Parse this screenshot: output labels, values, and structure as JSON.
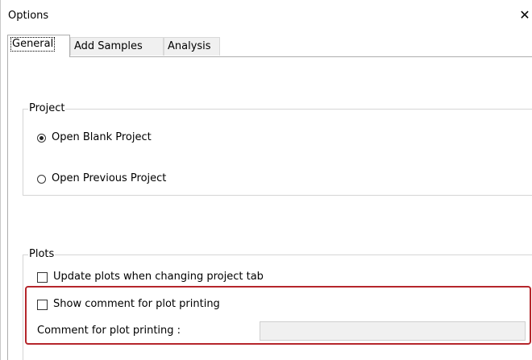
{
  "window": {
    "title": "Options",
    "close_glyph": "✕",
    "accent_highlight_color": "#b5262b"
  },
  "tabs": [
    {
      "label": "General",
      "active": true
    },
    {
      "label": "Add Samples",
      "active": false
    },
    {
      "label": "Analysis",
      "active": false
    }
  ],
  "project_group": {
    "legend": "Project",
    "options": [
      {
        "label": "Open Blank Project",
        "checked": true
      },
      {
        "label": "Open Previous Project",
        "checked": false
      }
    ]
  },
  "plots_group": {
    "legend": "Plots",
    "update_plots": {
      "label": "Update plots when changing project tab",
      "checked": false
    },
    "show_comment": {
      "label": "Show comment for plot printing",
      "checked": false
    },
    "comment_label": "Comment for plot printing :",
    "comment_value": "",
    "comment_placeholder": ""
  }
}
